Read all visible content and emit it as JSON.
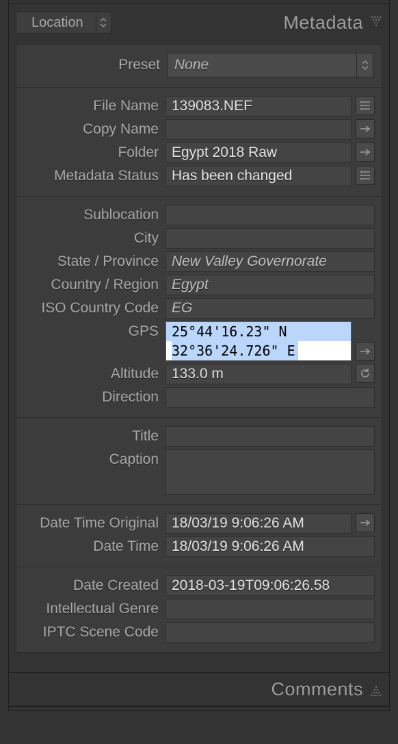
{
  "header": {
    "set_selector": "Location",
    "panel_title": "Metadata"
  },
  "preset": {
    "label": "Preset",
    "value": "None"
  },
  "file_group": {
    "file_name_label": "File Name",
    "file_name": "139083.NEF",
    "copy_name_label": "Copy Name",
    "copy_name": "",
    "folder_label": "Folder",
    "folder": "Egypt 2018 Raw",
    "metadata_status_label": "Metadata Status",
    "metadata_status": "Has been changed"
  },
  "loc_group": {
    "sublocation_label": "Sublocation",
    "sublocation": "",
    "city_label": "City",
    "city": "",
    "state_label": "State / Province",
    "state": "New Valley Governorate",
    "country_label": "Country / Region",
    "country": "Egypt",
    "iso_label": "ISO Country Code",
    "iso": "EG",
    "gps_label": "GPS",
    "gps_line1": "25°44'16.23\" N",
    "gps_line2": "32°36'24.726\" E",
    "altitude_label": "Altitude",
    "altitude": "133.0 m",
    "direction_label": "Direction",
    "direction": ""
  },
  "text_group": {
    "title_label": "Title",
    "title": "",
    "caption_label": "Caption",
    "caption": ""
  },
  "date_group": {
    "dt_orig_label": "Date Time Original",
    "dt_orig": "18/03/19 9:06:26 AM",
    "dt_label": "Date Time",
    "dt": "18/03/19 9:06:26 AM"
  },
  "created_group": {
    "date_created_label": "Date Created",
    "date_created": "2018-03-19T09:06:26.58",
    "genre_label": "Intellectual Genre",
    "genre": "",
    "scene_label": "IPTC Scene Code",
    "scene": ""
  },
  "comments": {
    "panel_title": "Comments"
  }
}
